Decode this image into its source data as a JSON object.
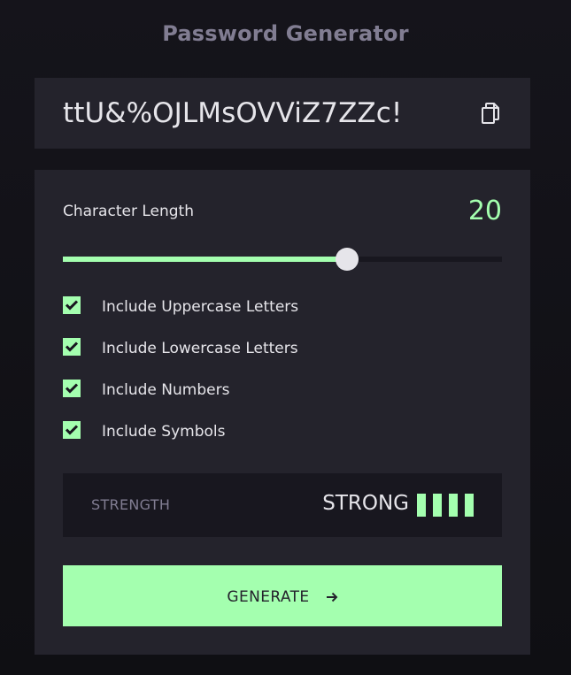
{
  "app": {
    "title": "Password Generator"
  },
  "password": {
    "value": "ttU&%OJLMsOVViZ7ZZc!",
    "copy_icon": "copy-icon"
  },
  "length": {
    "label": "Character Length",
    "value": "20",
    "min": 0,
    "max": 31,
    "slider_fraction": 0.648
  },
  "options": [
    {
      "label": "Include Uppercase Letters",
      "checked": true
    },
    {
      "label": "Include Lowercase Letters",
      "checked": true
    },
    {
      "label": "Include Numbers",
      "checked": true
    },
    {
      "label": "Include Symbols",
      "checked": true
    }
  ],
  "strength": {
    "label": "STRENGTH",
    "value": "STRONG",
    "level": 4,
    "max_level": 4
  },
  "generate": {
    "label": "GENERATE",
    "icon": "arrow-right-icon"
  },
  "colors": {
    "accent": "#a4ffaf",
    "panel": "#24232c",
    "dark": "#18171f",
    "muted": "#817d92",
    "text": "#e6e5ea"
  }
}
